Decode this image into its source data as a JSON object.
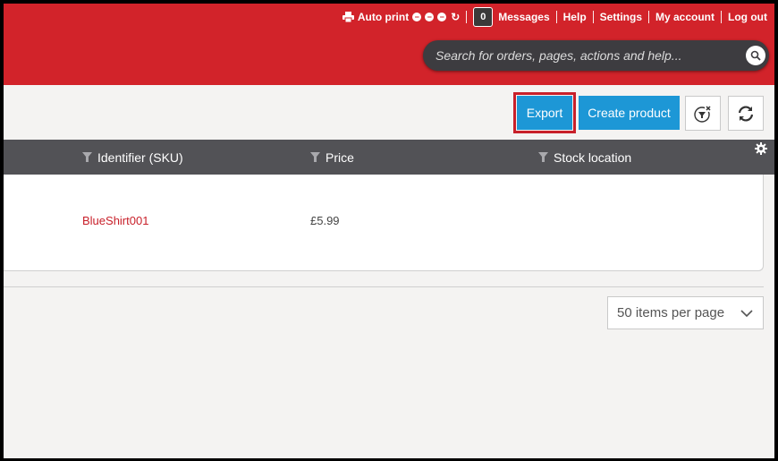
{
  "topnav": {
    "autoprint_label": "Auto print",
    "messages_count": "0",
    "messages_label": "Messages",
    "help_label": "Help",
    "settings_label": "Settings",
    "account_label": "My account",
    "logout_label": "Log out"
  },
  "search": {
    "placeholder": "Search for orders, pages, actions and help..."
  },
  "toolbar": {
    "export_label": "Export",
    "create_product_label": "Create product"
  },
  "table": {
    "columns": [
      "Identifier (SKU)",
      "Price",
      "Stock location"
    ],
    "rows": [
      {
        "sku": "BlueShirt001",
        "price": "£5.99",
        "stock_location": ""
      }
    ]
  },
  "pagination": {
    "per_page_label": "50 items per page"
  },
  "colors": {
    "header_red": "#d2232a",
    "button_blue": "#1d97d6",
    "table_header": "#525256",
    "sku_red": "#c8202a"
  },
  "icons": [
    "print-icon",
    "minus-circle-icon",
    "refresh-icon",
    "search-icon",
    "filter-clear-icon",
    "filter-icon",
    "gear-icon",
    "chevron-down-icon"
  ]
}
